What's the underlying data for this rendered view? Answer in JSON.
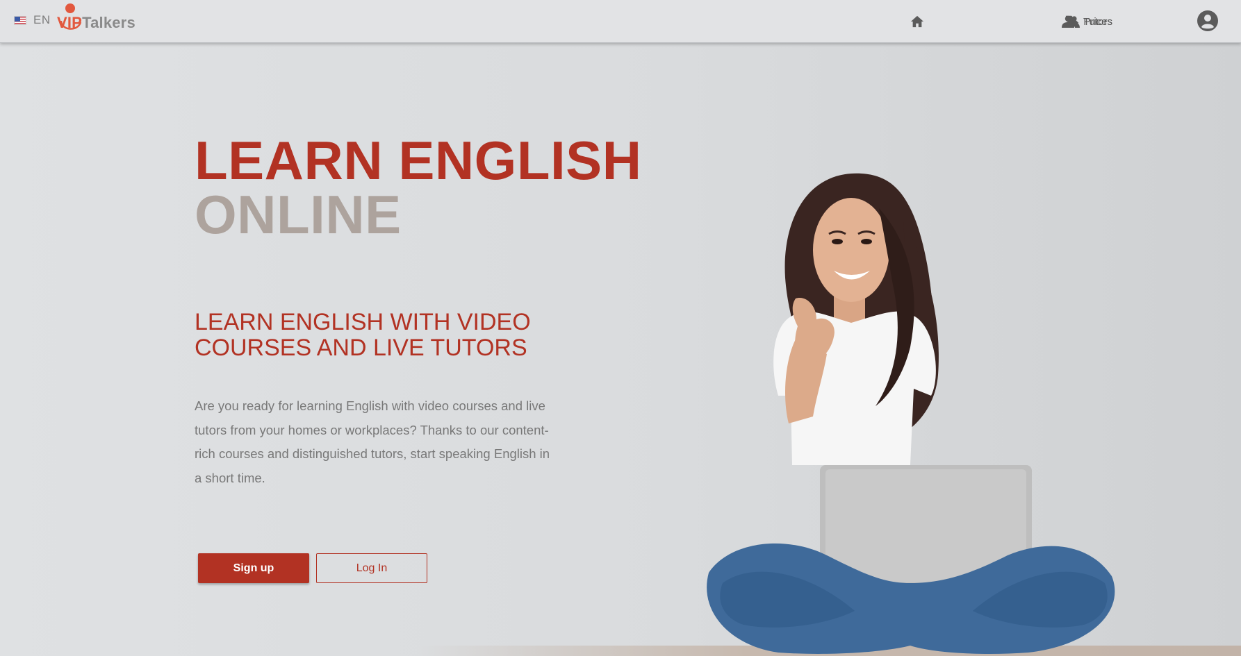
{
  "header": {
    "language": {
      "flag": "us-flag-icon",
      "label": "EN"
    },
    "logo": {
      "part1": "VIP",
      "part2": "Talkers",
      "accent_color": "#e2583e"
    },
    "nav": [
      {
        "icon": "home-icon",
        "label": ""
      },
      {
        "icon": "people-icon",
        "label": "Tutors"
      },
      {
        "icon": "tag-icon",
        "label": "Prices"
      },
      {
        "icon": "account-icon",
        "label": ""
      }
    ]
  },
  "hero": {
    "title_line1": "LEARN ENGLISH",
    "title_line2": "ONLINE",
    "subtitle": "LEARN ENGLISH WITH VIDEO COURSES AND LIVE TUTORS",
    "body": "Are you ready for learning English with video courses and live tutors from your homes or workplaces? Thanks to our content-rich courses and distinguished tutors, start speaking English in a short time.",
    "signup_label": "Sign up",
    "login_label": "Log In"
  },
  "colors": {
    "brand_red": "#b23223",
    "title_gray": "#ada39d",
    "body_gray": "#787878"
  }
}
